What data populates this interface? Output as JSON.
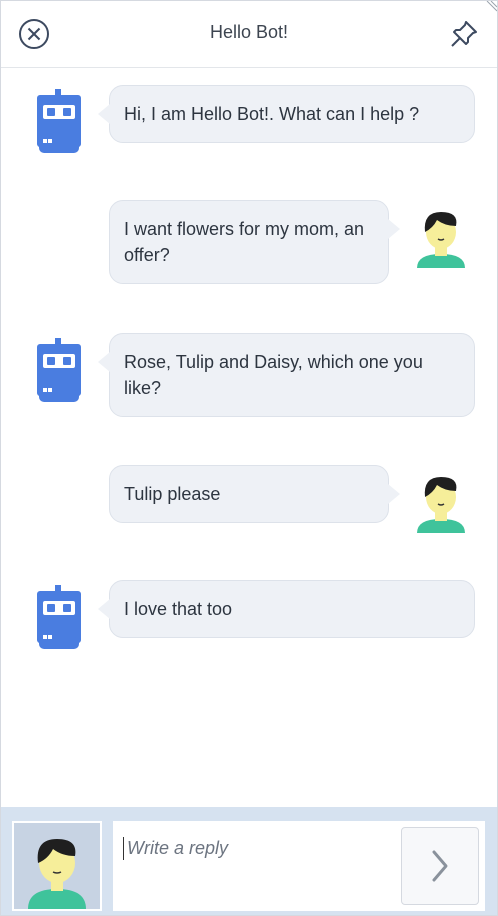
{
  "header": {
    "title": "Hello Bot!",
    "close_icon": "close-circle-icon",
    "pin_icon": "pin-icon"
  },
  "messages": [
    {
      "sender": "bot",
      "text": "Hi, I am Hello Bot!. What can I help ?"
    },
    {
      "sender": "user",
      "text": "I want flowers for my mom, an offer?"
    },
    {
      "sender": "bot",
      "text": "Rose, Tulip and Daisy, which one you like?"
    },
    {
      "sender": "user",
      "text": "Tulip please"
    },
    {
      "sender": "bot",
      "text": "I love that too"
    }
  ],
  "footer": {
    "reply_placeholder": "Write a reply",
    "send_icon": "chevron-right-icon"
  },
  "colors": {
    "bot_blue": "#4a7de0",
    "user_skin": "#f6ee9a",
    "user_shirt": "#3fc39b",
    "bubble_bg": "#eef1f6",
    "footer_bg": "#d6e2f0"
  }
}
